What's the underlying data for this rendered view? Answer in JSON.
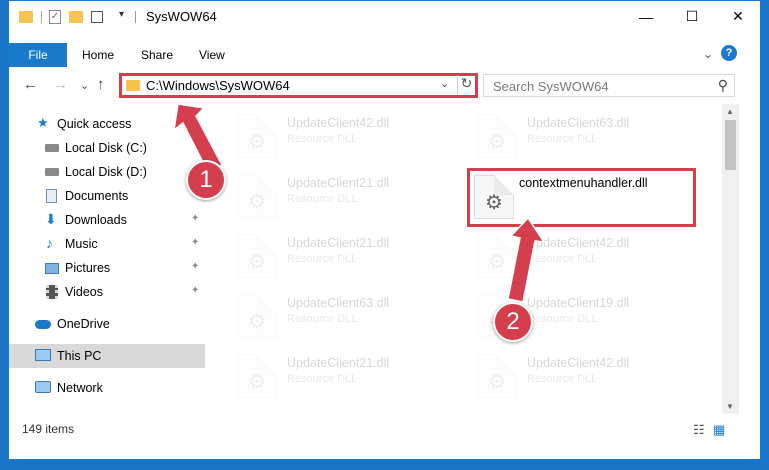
{
  "window": {
    "title": "SysWOW64",
    "controls": {
      "minimize": "—",
      "maximize": "☐",
      "close": "✕"
    }
  },
  "ribbon": {
    "tabs": [
      "File",
      "Home",
      "Share",
      "View"
    ],
    "expand_icon": "⌄",
    "help_icon": "?"
  },
  "nav": {
    "back": "←",
    "forward": "→",
    "recent": "⌄",
    "up": "↑",
    "address_path": "C:\\Windows\\SysWOW64",
    "address_dropdown": "⌄",
    "refresh": "↻",
    "search_placeholder": "Search SysWOW64",
    "search_icon": "⚲"
  },
  "sidebar": {
    "items": [
      {
        "label": "Quick access",
        "icon": "star-icon",
        "pinned": false
      },
      {
        "label": "Local Disk (C:)",
        "icon": "drive-icon",
        "pinned": false
      },
      {
        "label": "Local Disk (D:)",
        "icon": "drive-icon",
        "pinned": false
      },
      {
        "label": "Documents",
        "icon": "documents-icon",
        "pinned": true
      },
      {
        "label": "Downloads",
        "icon": "downloads-icon",
        "pinned": true
      },
      {
        "label": "Music",
        "icon": "music-icon",
        "pinned": true
      },
      {
        "label": "Pictures",
        "icon": "pictures-icon",
        "pinned": true
      },
      {
        "label": "Videos",
        "icon": "videos-icon",
        "pinned": true
      },
      {
        "label": "OneDrive",
        "icon": "cloud-icon",
        "pinned": false
      },
      {
        "label": "This PC",
        "icon": "computer-icon",
        "pinned": false,
        "selected": true
      },
      {
        "label": "Network",
        "icon": "network-icon",
        "pinned": false
      }
    ],
    "pin_glyph": "📌"
  },
  "files": {
    "left_column": [
      {
        "name": "UpdateClient42.dll",
        "type": "Resource DLL"
      },
      {
        "name": "UpdateClient21.dll",
        "type": "Resource DLL"
      },
      {
        "name": "UpdateClient21.dll",
        "type": "Resource DLL"
      },
      {
        "name": "UpdateClient63.dll",
        "type": "Resource DLL"
      },
      {
        "name": "UpdateClient21.dll",
        "type": "Resource DLL"
      }
    ],
    "right_column": [
      {
        "name": "UpdateClient63.dll",
        "type": "Resource DLL"
      },
      {
        "name": "contextmenuhandler.dll",
        "type": ""
      },
      {
        "name": "UpdateClient42.dll",
        "type": "Resource DLL"
      },
      {
        "name": "UpdateClient19.dll",
        "type": "Resource DLL"
      },
      {
        "name": "UpdateClient42.dll",
        "type": "Resource DLL"
      }
    ]
  },
  "status": {
    "item_count": "149 items",
    "details_view_icon": "☷",
    "tiles_view_icon": "▦"
  },
  "annotations": {
    "step1": "1",
    "step2": "2",
    "accent": "#d33f4d"
  }
}
